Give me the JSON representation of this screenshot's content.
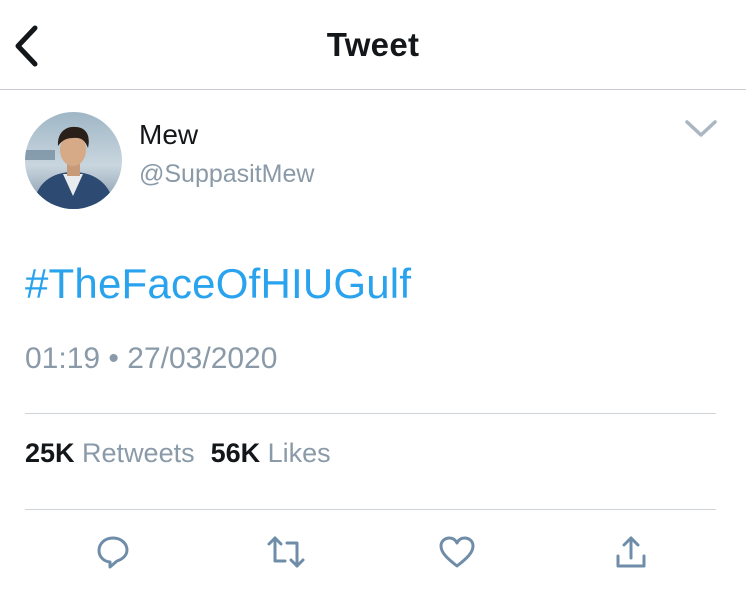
{
  "header": {
    "title": "Tweet",
    "back_icon": "chevron-left-icon"
  },
  "author": {
    "name": "Mew",
    "handle": "@SuppasitMew",
    "menu_icon": "chevron-down-icon"
  },
  "tweet": {
    "text": "#TheFaceOfHIUGulf",
    "time": "01:19",
    "separator": "•",
    "date": "27/03/2020"
  },
  "stats": {
    "retweets_count": "25K",
    "retweets_label": "Retweets",
    "likes_count": "56K",
    "likes_label": "Likes"
  },
  "actions": [
    {
      "icon": "reply-icon"
    },
    {
      "icon": "retweet-icon"
    },
    {
      "icon": "like-icon"
    },
    {
      "icon": "share-icon"
    }
  ],
  "colors": {
    "link": "#2aa3ef",
    "text_primary": "#14171a",
    "text_secondary": "#8a9aa8",
    "icon": "#6f8da8"
  }
}
